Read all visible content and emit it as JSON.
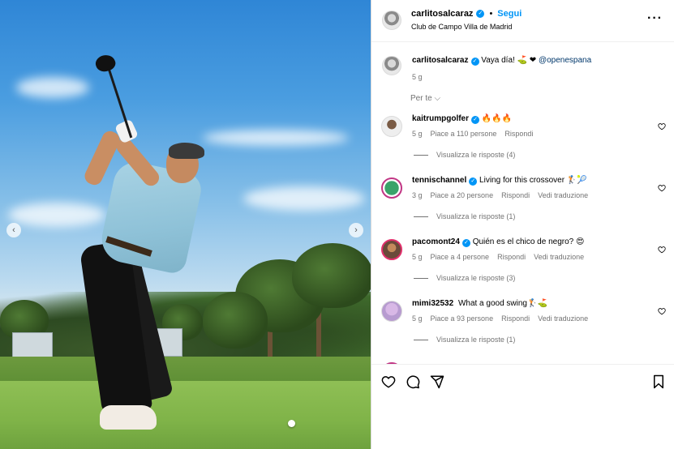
{
  "post": {
    "username": "carlitosalcaraz",
    "follow_label": "Segui",
    "separator": "•",
    "location": "Club de Campo Villa de Madrid",
    "more_label": "···"
  },
  "caption": {
    "username": "carlitosalcaraz",
    "text": "Vaya día! ⛳ ❤",
    "mention": "@openespana",
    "time": "5 g"
  },
  "sort_label": "Per te",
  "comments": [
    {
      "username": "kaitrumpgolfer",
      "text": "🔥🔥🔥",
      "time": "5 g",
      "likes": "Piace a 110 persone",
      "reply": "Rispondi",
      "translate": "",
      "view_replies": "Visualizza le risposte (4)"
    },
    {
      "username": "tennischannel",
      "text": "Living for this crossover 🏌️🎾",
      "time": "3 g",
      "likes": "Piace a 20 persone",
      "reply": "Rispondi",
      "translate": "Vedi traduzione",
      "view_replies": "Visualizza le risposte (1)"
    },
    {
      "username": "pacomont24",
      "text": "Quién es el chico de negro? 😍",
      "time": "5 g",
      "likes": "Piace a 4 persone",
      "reply": "Rispondi",
      "translate": "Vedi traduzione",
      "view_replies": "Visualizza le risposte (3)"
    },
    {
      "username": "mimi32532",
      "text": "What a good swing🏌️⛳",
      "time": "5 g",
      "likes": "Piace a 93 persone",
      "reply": "Rispondi",
      "translate": "Vedi traduzione",
      "view_replies": "Visualizza le risposte (1)"
    }
  ],
  "icons": {
    "like": "heart-icon",
    "comment": "comment-icon",
    "share": "share-icon",
    "save": "bookmark-icon",
    "verified": "verified-badge-icon"
  },
  "colors": {
    "link": "#0095f6",
    "verified": "#0095f6",
    "mention": "#00376b",
    "muted": "#737373"
  }
}
